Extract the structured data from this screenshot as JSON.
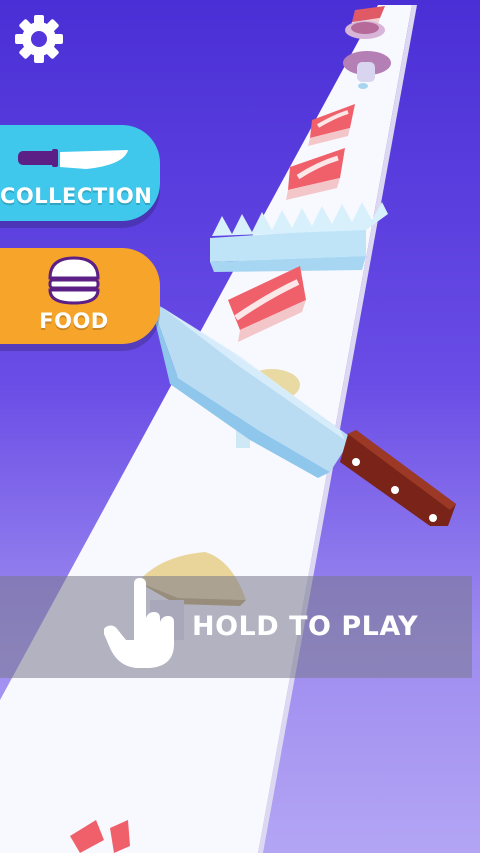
{
  "settings": {
    "icon": "gear-icon"
  },
  "menu": {
    "collection": {
      "label": "COLLECTION",
      "icon": "kitchen-knife-icon",
      "color": "#3fc8ec"
    },
    "food": {
      "label": "FOOD",
      "icon": "burger-icon",
      "color": "#f7a42a"
    }
  },
  "prompt": {
    "text": "HOLD TO PLAY",
    "icon": "tap-hand-icon"
  },
  "colors": {
    "background_top": "#4a2fd6",
    "background_bottom": "#b3a5f4",
    "track": "#ffffff",
    "steak": "#f0606b",
    "knife_handle": "#7a2318"
  }
}
